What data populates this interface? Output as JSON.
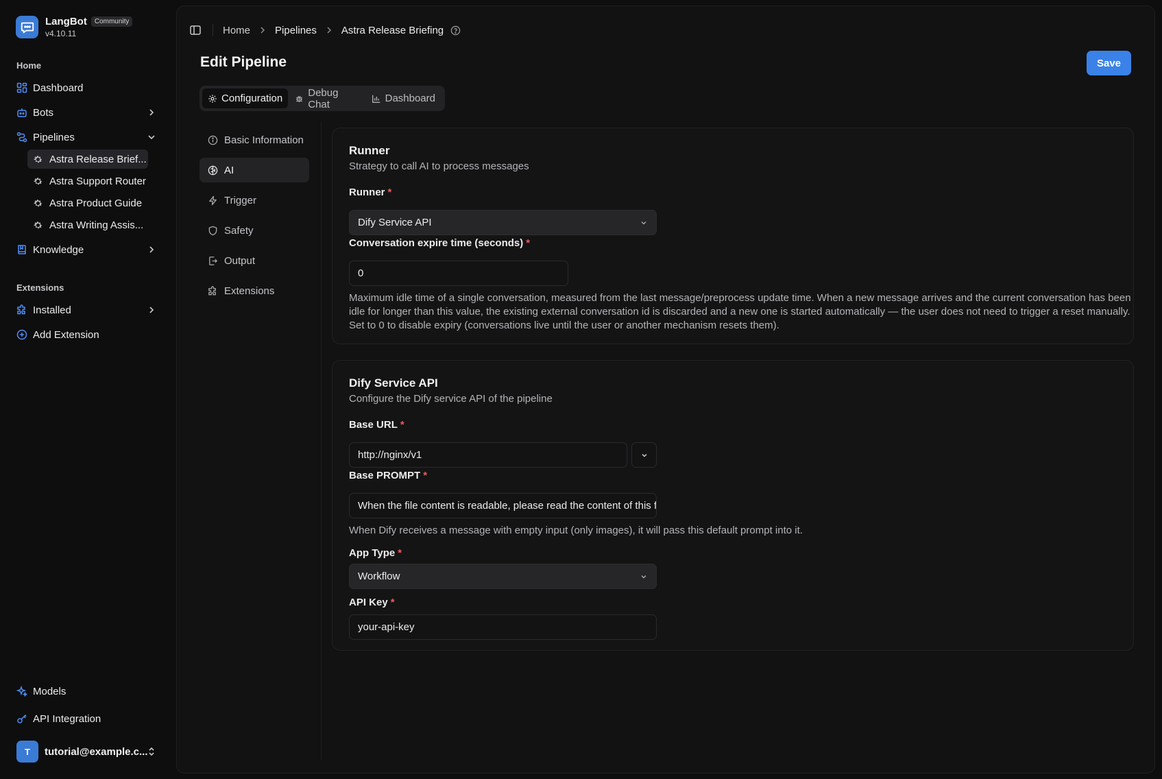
{
  "brand": {
    "name": "LangBot",
    "badge": "Community",
    "version": "v4.10.11"
  },
  "sidebar": {
    "home_label": "Home",
    "extensions_label": "Extensions",
    "items": {
      "dashboard": "Dashboard",
      "bots": "Bots",
      "pipelines": "Pipelines",
      "knowledge": "Knowledge",
      "installed": "Installed",
      "add_extension": "Add Extension",
      "models": "Models",
      "api_integration": "API Integration"
    },
    "pipelines": [
      "Astra Release Brief...",
      "Astra Support Router",
      "Astra Product Guide",
      "Astra Writing Assis..."
    ],
    "user": {
      "initial": "T",
      "email": "tutorial@example.c..."
    }
  },
  "breadcrumb": [
    "Home",
    "Pipelines",
    "Astra Release Briefing"
  ],
  "page": {
    "title": "Edit Pipeline",
    "save_label": "Save"
  },
  "tabs": [
    "Configuration",
    "Debug Chat",
    "Dashboard"
  ],
  "subnav": [
    "Basic Information",
    "AI",
    "Trigger",
    "Safety",
    "Output",
    "Extensions"
  ],
  "runner_card": {
    "title": "Runner",
    "description": "Strategy to call AI to process messages",
    "runner_label": "Runner",
    "runner_value": "Dify Service API",
    "expire_label": "Conversation expire time (seconds)",
    "expire_value": "0",
    "expire_help_1": "Maximum idle time of a single conversation, measured from the last message/preprocess update time. When a new message arrives and the current conversation has been",
    "expire_help_2": "idle for longer than this value, the existing external conversation id is discarded and a new one is started automatically — the user does not need to trigger a reset manually.",
    "expire_help_3": "Set to 0 to disable expiry (conversations live until the user or another mechanism resets them)."
  },
  "dify_card": {
    "title": "Dify Service API",
    "description": "Configure the Dify service API of the pipeline",
    "base_url_label": "Base URL",
    "base_url_value": "http://nginx/v1",
    "base_prompt_label": "Base PROMPT",
    "base_prompt_value": "When the file content is readable, please read the content of this file",
    "base_prompt_help": "When Dify receives a message with empty input (only images), it will pass this default prompt into it.",
    "app_type_label": "App Type",
    "app_type_value": "Workflow",
    "api_key_label": "API Key",
    "api_key_value": "your-api-key"
  },
  "colors": {
    "accent": "#3a82e8",
    "required": "#ef5a5a",
    "icon_blue": "#4f8ff7"
  }
}
